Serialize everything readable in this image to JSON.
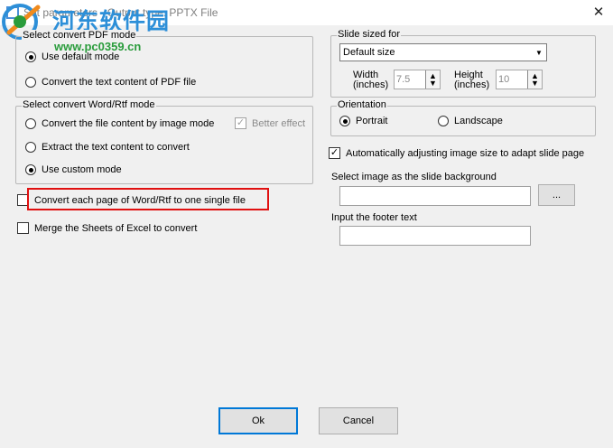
{
  "window": {
    "title": "Set parameters - Output type: PPTX File",
    "close_label": "✕"
  },
  "watermark": {
    "site_name": "河东软件园",
    "url": "www.pc0359.cn"
  },
  "pdf_mode": {
    "legend": "Select convert PDF mode",
    "options": [
      {
        "label": "Use default mode",
        "selected": true
      },
      {
        "label": "Convert the text content of PDF file",
        "selected": false
      }
    ]
  },
  "word_mode": {
    "legend": "Select convert Word/Rtf mode",
    "options": [
      {
        "label": "Convert the file content by image mode",
        "selected": false
      },
      {
        "label": "Extract the text content to convert",
        "selected": false
      },
      {
        "label": "Use custom mode",
        "selected": true
      }
    ],
    "better_effect": {
      "label": "Better effect",
      "checked": true,
      "enabled": false
    }
  },
  "convert_each_page": {
    "label": "Convert each page of Word/Rtf to one single file",
    "checked": false
  },
  "merge_sheets": {
    "label": "Merge the Sheets of Excel to convert",
    "checked": false
  },
  "slide_size": {
    "legend": "Slide sized for",
    "selected": "Default size",
    "width_label": "Width",
    "width_unit": "(inches)",
    "width_value": "7.5",
    "height_label": "Height",
    "height_unit": "(inches)",
    "height_value": "10"
  },
  "orientation": {
    "legend": "Orientation",
    "options": [
      {
        "label": "Portrait",
        "selected": true
      },
      {
        "label": "Landscape",
        "selected": false
      }
    ]
  },
  "auto_adjust": {
    "label": "Automatically adjusting image size to adapt slide page",
    "checked": true
  },
  "background": {
    "label": "Select image as the slide background",
    "value": "",
    "browse_label": "..."
  },
  "footer": {
    "label": "Input the footer text",
    "value": ""
  },
  "buttons": {
    "ok": "Ok",
    "cancel": "Cancel"
  },
  "colors": {
    "highlight": "#e01010",
    "watermark_blue": "#2d8fd8",
    "watermark_green": "#2a9c3c"
  }
}
